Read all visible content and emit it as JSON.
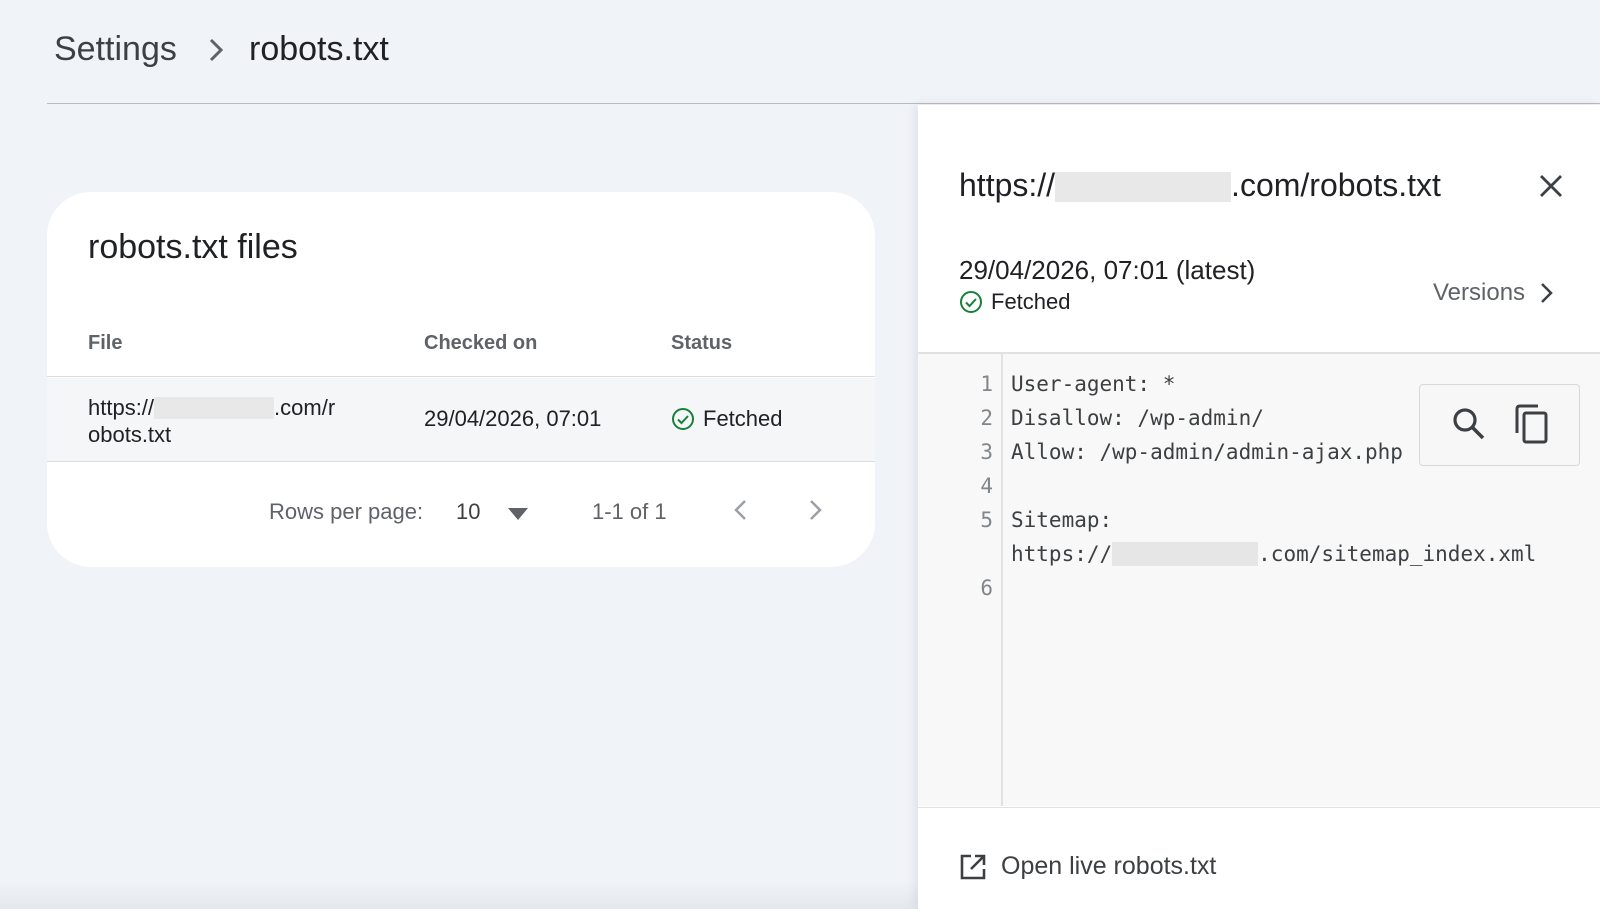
{
  "breadcrumb": {
    "root": "Settings",
    "current": "robots.txt"
  },
  "card": {
    "title": "robots.txt files",
    "columns": [
      "File",
      "Checked on",
      "Status"
    ],
    "rows": [
      {
        "file_prefix": "https://",
        "file_suffix": ".com/r",
        "file_line2": "obots.txt",
        "checked_on": "29/04/2026, 07:01",
        "status": "Fetched"
      }
    ],
    "pagination": {
      "rows_per_page_label": "Rows per page:",
      "rows_per_page_value": "10",
      "range": "1-1 of 1"
    }
  },
  "panel": {
    "title_prefix": "https://",
    "title_suffix": ".com/robots.txt",
    "date": "29/04/2026, 07:01 (latest)",
    "status": "Fetched",
    "versions_label": "Versions",
    "code_lines": [
      {
        "num": "1",
        "text": "User-agent: *"
      },
      {
        "num": "2",
        "text": "Disallow: /wp-admin/"
      },
      {
        "num": "3",
        "text": "Allow: /wp-admin/admin-ajax.php"
      },
      {
        "num": "4",
        "text": ""
      },
      {
        "num": "5",
        "text": "Sitemap:"
      },
      {
        "num": "",
        "text_prefix": "https://",
        "text_suffix": ".com/sitemap_index.xml"
      },
      {
        "num": "6",
        "text": ""
      }
    ],
    "footer_link": "Open live robots.txt"
  },
  "colors": {
    "background": "#f0f3f8",
    "success": "#188038",
    "text": "#202124",
    "muted": "#5f6368"
  },
  "icons": [
    "chevron-right-icon",
    "check-circle-icon",
    "dropdown-arrow-icon",
    "chevron-left-icon",
    "close-icon",
    "search-icon",
    "copy-icon",
    "open-in-new-icon"
  ]
}
